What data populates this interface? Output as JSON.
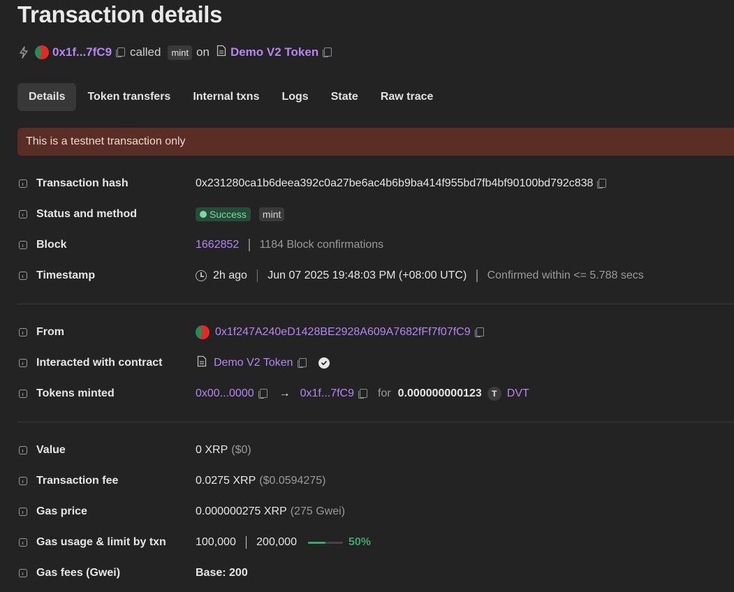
{
  "page_title": "Transaction details",
  "summary": {
    "from_short": "0x1f...7fC9",
    "called_text": "called",
    "method": "mint",
    "on_text": "on",
    "contract_name": "Demo V2 Token"
  },
  "tabs": [
    {
      "label": "Details",
      "active": true
    },
    {
      "label": "Token transfers"
    },
    {
      "label": "Internal txns"
    },
    {
      "label": "Logs"
    },
    {
      "label": "State"
    },
    {
      "label": "Raw trace"
    }
  ],
  "banner": "This is a testnet transaction only",
  "details": {
    "tx_hash": {
      "label": "Transaction hash",
      "value": "0x231280ca1b6deea392c0a27be6ac4b6b9ba414f955bd7fb4bf90100bd792c838"
    },
    "status": {
      "label": "Status and method",
      "status": "Success",
      "method": "mint"
    },
    "block": {
      "label": "Block",
      "number": "1662852",
      "confirmations": "1184 Block confirmations"
    },
    "timestamp": {
      "label": "Timestamp",
      "relative": "2h ago",
      "absolute": "Jun 07 2025 19:48:03 PM (+08:00 UTC)",
      "confirmed": "Confirmed within <= 5.788 secs"
    },
    "from": {
      "label": "From",
      "address": "0x1f247A240eD1428BE2928A609A7682fFf7f07fC9"
    },
    "contract": {
      "label": "Interacted with contract",
      "name": "Demo V2 Token"
    },
    "tokens": {
      "label": "Tokens minted",
      "from": "0x00...0000",
      "arrow": "→",
      "to": "0x1f...7fC9",
      "for_text": "for",
      "amount": "0.000000000123",
      "token_letter": "T",
      "token_symbol": "DVT"
    },
    "value": {
      "label": "Value",
      "amount": "0 XRP",
      "usd": "($0)"
    },
    "fee": {
      "label": "Transaction fee",
      "amount": "0.0275 XRP",
      "usd": "($0.0594275)"
    },
    "gas_price": {
      "label": "Gas price",
      "amount": "0.000000275 XRP",
      "gwei": "(275 Gwei)"
    },
    "gas_usage": {
      "label": "Gas usage & limit by txn",
      "used": "100,000",
      "limit": "200,000",
      "percent_text": "50%",
      "percent": 0.5
    },
    "gas_fees": {
      "label": "Gas fees (Gwei)",
      "base": "Base: 200"
    }
  },
  "colors": {
    "accent": "#b586f2",
    "success": "#3fa66b",
    "banner_bg": "#5a2e24",
    "background": "#232323"
  }
}
